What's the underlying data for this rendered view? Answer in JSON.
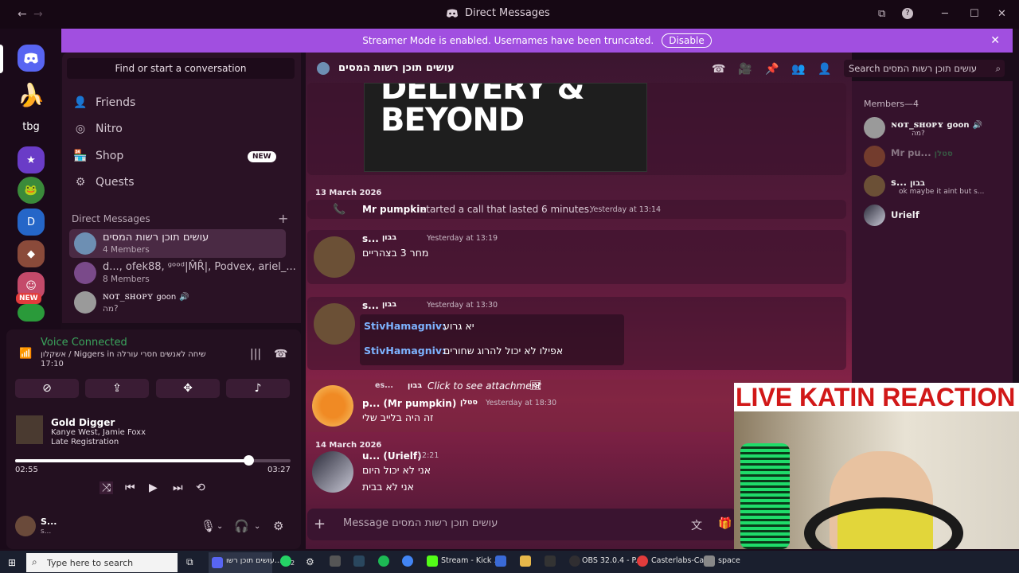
{
  "window": {
    "title": "Direct Messages",
    "title_icon": "discord-logo-icon"
  },
  "banner": {
    "text": "Streamer Mode is enabled. Usernames have been truncated.",
    "button": "Disable"
  },
  "rail": {
    "new_badge": "NEW",
    "tbg_label": "tbg"
  },
  "sidebar": {
    "search_placeholder": "Find or start a conversation",
    "nav": [
      {
        "label": "Friends",
        "icon": "friends-icon"
      },
      {
        "label": "Nitro",
        "icon": "nitro-icon"
      },
      {
        "label": "Shop",
        "icon": "shop-icon",
        "badge": "NEW"
      },
      {
        "label": "Quests",
        "icon": "quests-icon"
      }
    ],
    "dm_header": "Direct Messages",
    "dm_add": "+",
    "dms": [
      {
        "name": "עושים תוכן רשות המסים",
        "sub": "4 Members"
      },
      {
        "name": "d..., ofek88, ᵍᵒᵒᵈ|M̂R̂|, Podvex, ariel_...",
        "sub": "8 Members"
      },
      {
        "name": "ɴᴏᴛ_ꜱʜᴏᴘʏ",
        "role": "goon",
        "sub": "מה?"
      }
    ]
  },
  "voice": {
    "status": "Voice Connected",
    "channel": "אשקלון / Niggers in שיחה לאנשים חסרי עורלה",
    "time": "17:10"
  },
  "music": {
    "title": "Gold Digger",
    "artist": "Kanye West, Jamie Foxx",
    "album": "Late Registration",
    "current": "02:55",
    "total": "03:27",
    "progress_fraction": 0.846
  },
  "user": {
    "name": "S...",
    "sub": "s..."
  },
  "chat": {
    "channel_title": "עושים תוכן רשות המסים",
    "search_placeholder": "Search עושים תוכן רשות המסים",
    "embed_text": "DELIVERY & BEYOND",
    "composer_placeholder": "Message עושים תוכן רשות המסים",
    "day1": "13 March 2026",
    "call": {
      "user": "Mr pumpkin",
      "text": "started a call that lasted 6 minutes.",
      "time": "Yesterday at 13:14"
    },
    "m1": {
      "user": "s...",
      "tag": "בבון",
      "time": "Yesterday at 13:19",
      "text": "מחר 3 בצהריים"
    },
    "m2": {
      "user": "s...",
      "tag": "בבון",
      "time": "Yesterday at 13:30",
      "lines": [
        {
          "who": "StivHamagniv:",
          "text": "יא גרוע"
        },
        {
          "who": "StivHamagniv:",
          "text": "אפילו לא יכול להרוג שחורים"
        }
      ]
    },
    "m3": {
      "reply_user": "es...",
      "reply_tag": "בבון",
      "reply_text": "Click to see attachment",
      "user": "p... (Mr pumpkin)",
      "tag": "סטלן",
      "time": "Yesterday at 18:30",
      "text": "זה היה בלייב שלי"
    },
    "day2": "14 March 2026",
    "m4": {
      "user": "u... (Urielf)",
      "time": "12:21",
      "lines": [
        "אני לא יכול היום",
        "אני לא בבית"
      ]
    }
  },
  "members": {
    "header": "Members—4",
    "list": [
      {
        "name": "ɴᴏᴛ_ꜱʜᴏᴘʏ",
        "role": "goon",
        "sub": "מה?"
      },
      {
        "name": "Mr pu...",
        "role": "סטלן",
        "sub": ""
      },
      {
        "name": "s...",
        "role": "בבון",
        "sub": "ok maybe it aint but s..."
      },
      {
        "name": "Urielf",
        "role": "",
        "sub": ""
      }
    ]
  },
  "overlay": {
    "title": "LIVE KATIN REACTION"
  },
  "taskbar": {
    "search": "Type here to search",
    "items": [
      "עושים תוכן רשו...",
      "Stream - Kick ...",
      "OBS 32.0.4 - P...",
      "Casterlabs-Ca...",
      "space"
    ],
    "whatsapp_count": "2"
  },
  "colors": {
    "accent": "#a14fe0",
    "online": "#3ba55d",
    "live_red": "#d11818"
  }
}
